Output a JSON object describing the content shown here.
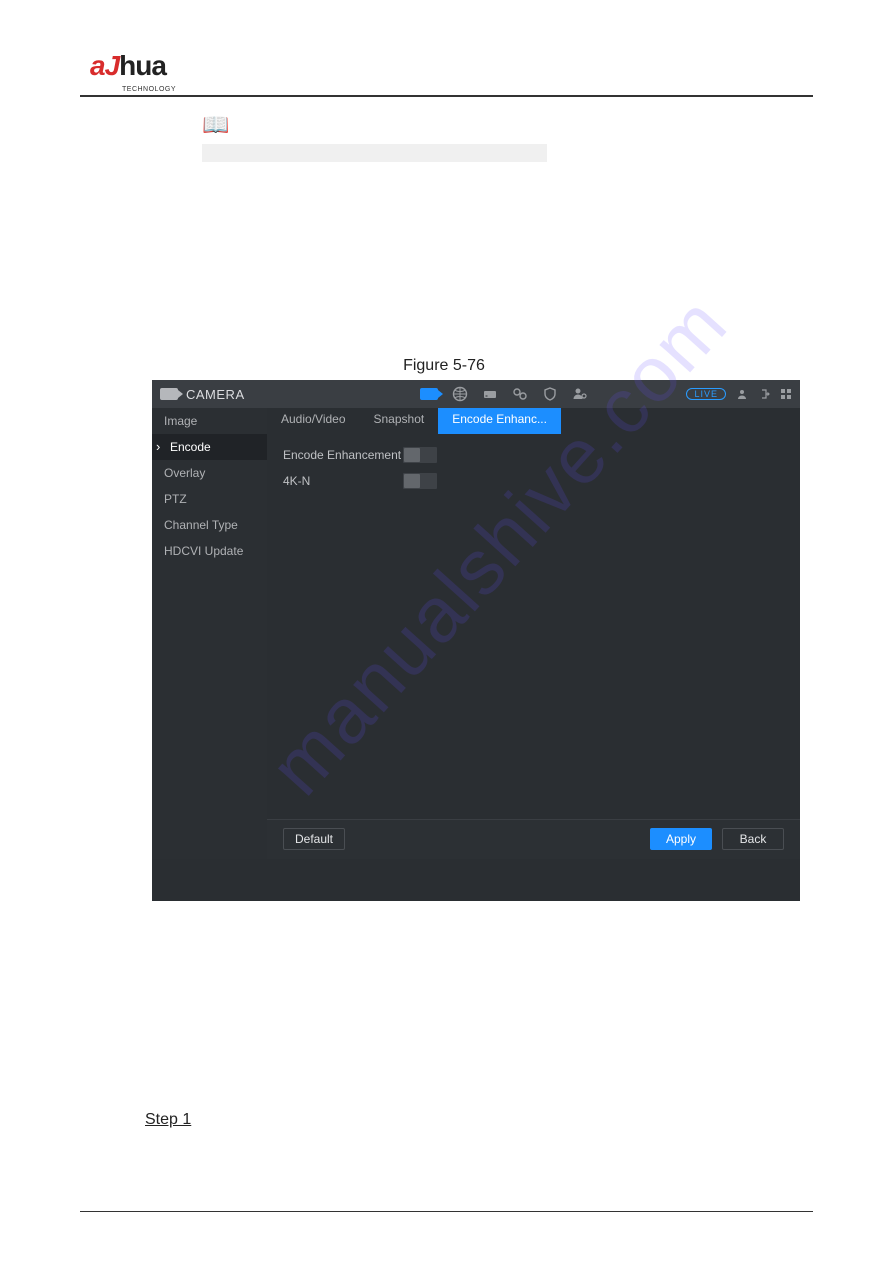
{
  "logo": {
    "prefix": "a",
    "slash": "J",
    "suffix": "hua",
    "sub": "TECHNOLOGY"
  },
  "figure_caption": "Figure 5-76",
  "window": {
    "title": "CAMERA",
    "live_badge": "LIVE",
    "sidebar": [
      {
        "label": "Image",
        "active": false
      },
      {
        "label": "Encode",
        "active": true
      },
      {
        "label": "Overlay",
        "active": false
      },
      {
        "label": "PTZ",
        "active": false
      },
      {
        "label": "Channel Type",
        "active": false
      },
      {
        "label": "HDCVI Update",
        "active": false
      }
    ],
    "tabs": [
      {
        "label": "Audio/Video",
        "active": false
      },
      {
        "label": "Snapshot",
        "active": false
      },
      {
        "label": "Encode Enhanc...",
        "active": true
      }
    ],
    "fields": [
      {
        "label": "Encode Enhancement",
        "on": false
      },
      {
        "label": "4K-N",
        "on": false
      }
    ],
    "buttons": {
      "default": "Default",
      "apply": "Apply",
      "back": "Back"
    }
  },
  "watermark": "manualshive.com",
  "step_label": "Step 1"
}
